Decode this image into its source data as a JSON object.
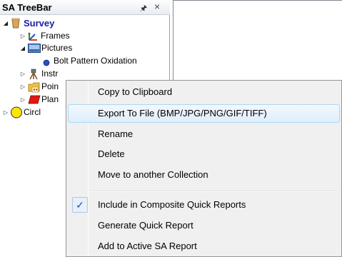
{
  "panel": {
    "title": "SA TreeBar",
    "pin_glyph": "⌧",
    "close_glyph": "×"
  },
  "tree": {
    "survey": "Survey",
    "frames": "Frames",
    "pictures": "Pictures",
    "picture_item": "Bolt Pattern Oxidation",
    "instruments": "Instr",
    "points": "Poin",
    "planes": "Plan",
    "circles": "Circl"
  },
  "context_menu": {
    "items": [
      {
        "label": "Copy to Clipboard"
      },
      {
        "label": "Export To File (BMP/JPG/PNG/GIF/TIFF)"
      },
      {
        "label": "Rename"
      },
      {
        "label": "Delete"
      },
      {
        "label": "Move to another Collection"
      },
      {
        "label": "Include in Composite Quick Reports",
        "checked": true
      },
      {
        "label": "Generate Quick Report"
      },
      {
        "label": "Add to Active SA Report"
      }
    ],
    "check_glyph": "✓"
  },
  "colors": {
    "accent": "#1a1aaa",
    "hover_border": "#a8d8f0",
    "menu_bg": "#f0f0f0"
  }
}
